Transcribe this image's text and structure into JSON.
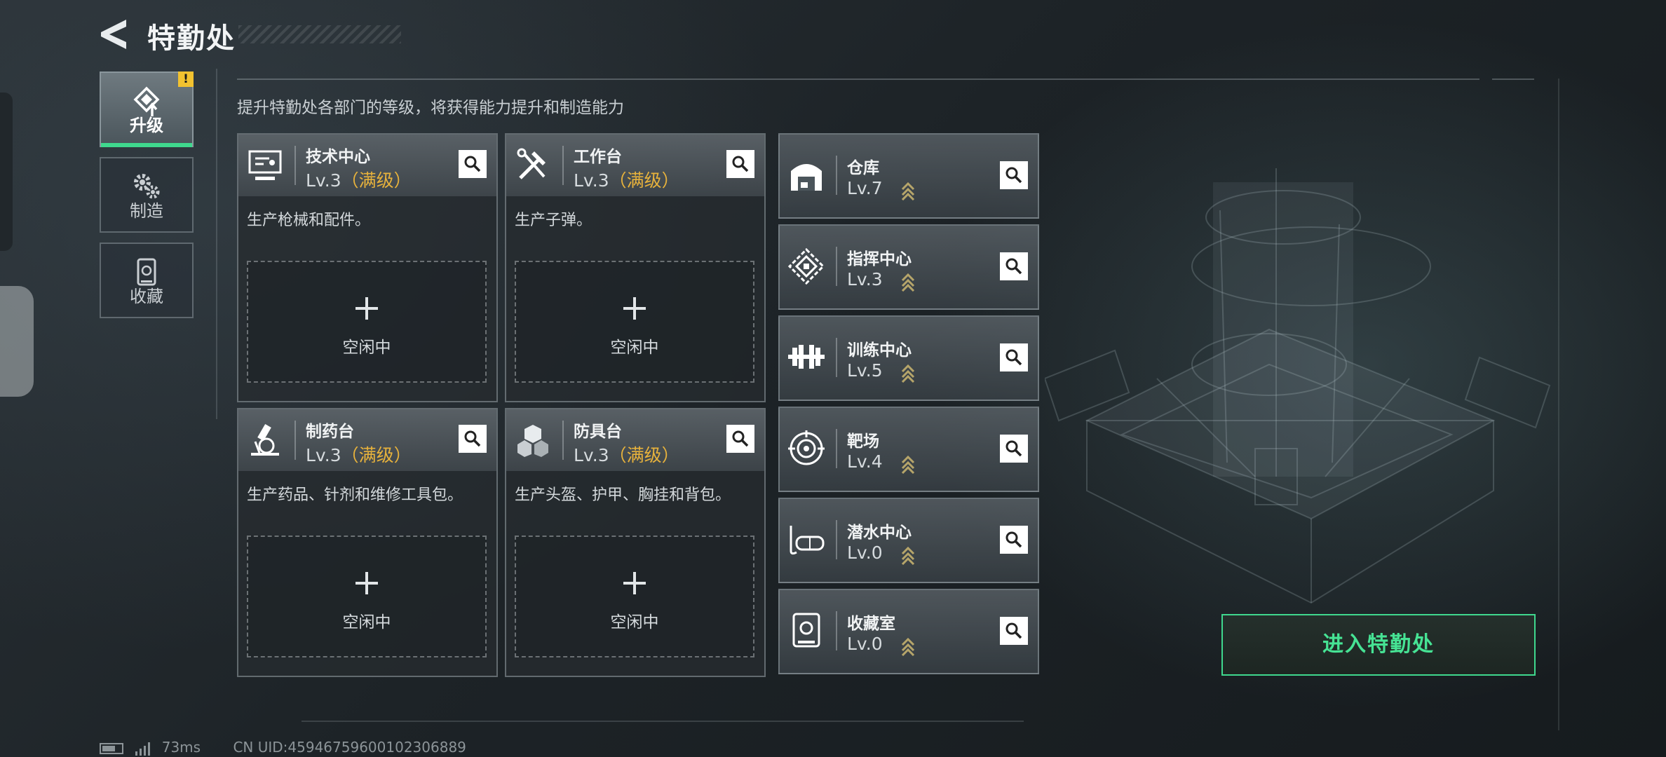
{
  "header": {
    "title": "特勤处",
    "subtitle": "提升特勤处各部门的等级，将获得能力提升和制造能力"
  },
  "nav": [
    {
      "label": "升级",
      "icon": "upgrade-icon",
      "active": true,
      "badge": "!"
    },
    {
      "label": "制造",
      "icon": "gear-icon",
      "active": false
    },
    {
      "label": "收藏",
      "icon": "collection-icon",
      "active": false
    }
  ],
  "workshops": [
    {
      "name": "技术中心",
      "level": "Lv.3",
      "max_tag": "（满级）",
      "desc": "生产枪械和配件。",
      "slot_status": "空闲中",
      "icon": "tech-center-icon"
    },
    {
      "name": "工作台",
      "level": "Lv.3",
      "max_tag": "（满级）",
      "desc": "生产子弹。",
      "slot_status": "空闲中",
      "icon": "workbench-icon"
    },
    {
      "name": "制药台",
      "level": "Lv.3",
      "max_tag": "（满级）",
      "desc": "生产药品、针剂和维修工具包。",
      "slot_status": "空闲中",
      "icon": "pharmacy-icon"
    },
    {
      "name": "防具台",
      "level": "Lv.3",
      "max_tag": "（满级）",
      "desc": "生产头盔、护甲、胸挂和背包。",
      "slot_status": "空闲中",
      "icon": "armor-bench-icon"
    }
  ],
  "buildings": [
    {
      "name": "仓库",
      "level": "Lv.7",
      "icon": "warehouse-icon"
    },
    {
      "name": "指挥中心",
      "level": "Lv.3",
      "icon": "command-center-icon"
    },
    {
      "name": "训练中心",
      "level": "Lv.5",
      "icon": "training-center-icon"
    },
    {
      "name": "靶场",
      "level": "Lv.4",
      "icon": "shooting-range-icon"
    },
    {
      "name": "潜水中心",
      "level": "Lv.0",
      "icon": "diving-center-icon"
    },
    {
      "name": "收藏室",
      "level": "Lv.0",
      "icon": "collection-room-icon"
    }
  ],
  "enter_button": "进入特勤处",
  "status_bar": {
    "ping": "73ms",
    "uid": "CN UID:45946759600102306889"
  },
  "colors": {
    "accent_green": "#3fd88e",
    "max_level": "#e7b23c",
    "warning": "#f2c230"
  }
}
